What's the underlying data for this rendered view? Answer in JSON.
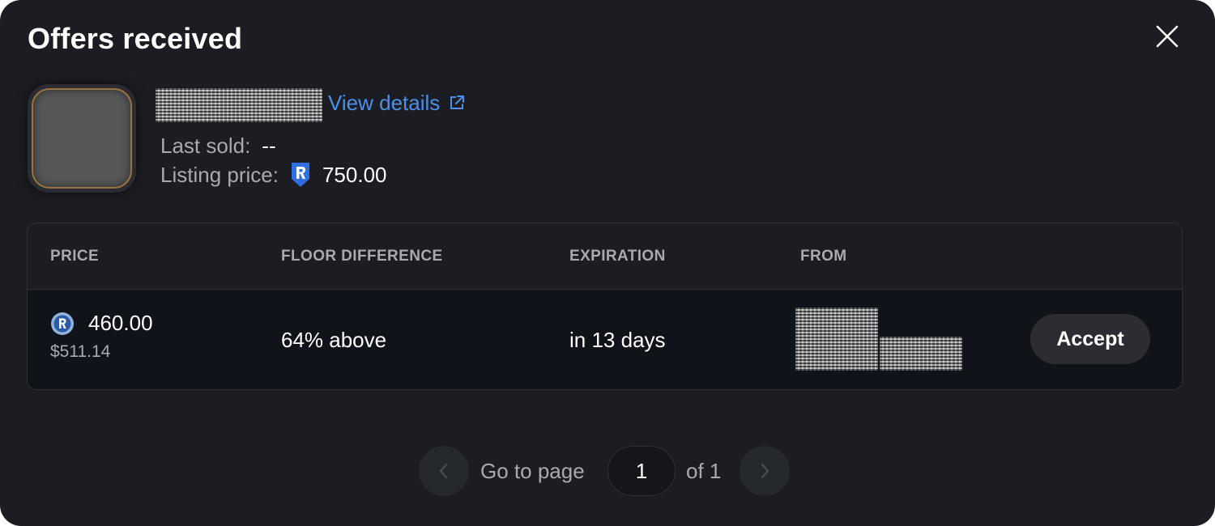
{
  "modal": {
    "title": "Offers received"
  },
  "item": {
    "view_details_label": "View details",
    "last_sold_label": "Last sold:",
    "last_sold_value": "--",
    "listing_price_label": "Listing price:",
    "listing_price_value": "750.00"
  },
  "table": {
    "headers": [
      "PRICE",
      "FLOOR DIFFERENCE",
      "EXPIRATION",
      "FROM"
    ],
    "rows": [
      {
        "price": "460.00",
        "price_usd": "$511.14",
        "floor_difference": "64% above",
        "expiration": "in 13 days",
        "action_label": "Accept"
      }
    ]
  },
  "pagination": {
    "go_to_label": "Go to page",
    "current_page": "1",
    "of_label": "of 1"
  },
  "colors": {
    "background": "#1b1d22",
    "row_background": "#10131a",
    "link": "#4d8fe6",
    "muted_text": "#a7aab0",
    "button": "#2b2d32"
  },
  "icons": [
    "close-icon",
    "external-link-icon",
    "shield-currency-icon",
    "coin-icon",
    "chevron-left-icon",
    "chevron-right-icon"
  ]
}
